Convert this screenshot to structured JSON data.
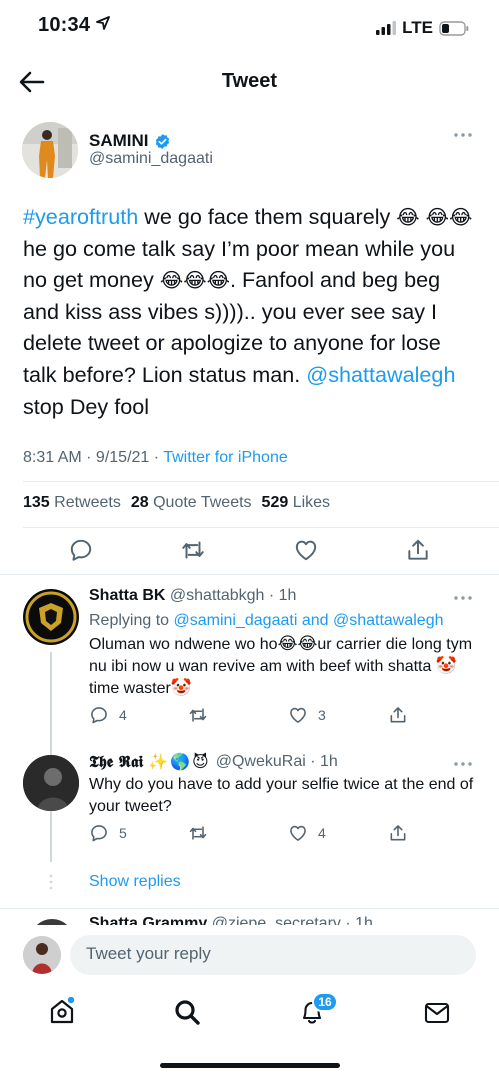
{
  "status_bar": {
    "time": "10:34",
    "network": "LTE"
  },
  "header": {
    "title": "Tweet"
  },
  "main_tweet": {
    "name": "SAMINI",
    "handle": "@samini_dagaati",
    "hashtag": "#yearoftruth",
    "text_1": " we go face them squarely ",
    "text_2": " he go come talk say I’m poor mean while you no get money ",
    "text_3": ". Fanfool and beg beg and kiss ass vibes s)))).. you ever see say I delete tweet or apologize to anyone for lose talk before? Lion status man. ",
    "mention": "@shattawalegh",
    "text_4": " stop Dey fool",
    "emoji": "😂",
    "time": "8:31 AM · 9/15/21 · ",
    "source": "Twitter for iPhone",
    "stats": {
      "retweets": "135",
      "retweets_label": "Retweets",
      "quotes": "28",
      "quotes_label": "Quote Tweets",
      "likes": "529",
      "likes_label": "Likes"
    }
  },
  "replies": [
    {
      "name": "Shatta BK",
      "handle": "@shattabkgh · 1h",
      "replying_prefix": "Replying to ",
      "replying_to": "@samini_dagaati and @shattawalegh",
      "text_1": "Oluman wo ndwene wo ho",
      "emoji_laugh": "😂",
      "text_2": "ur carrier die long tym nu ibi now u wan revive am with beef with shatta ",
      "emoji_clown": "🤡",
      "text_3": "time waster",
      "reply_count": "4",
      "like_count": "3"
    },
    {
      "name": "𝕿𝖍𝖊 𝕽𝖆𝖎",
      "name_emojis": "✨🌎😈",
      "handle": "@QwekuRai · 1h",
      "text": "Why do you have to add your selfie twice at the end of your tweet?",
      "reply_count": "5",
      "like_count": "4"
    }
  ],
  "show_replies": "Show replies",
  "partial_reply": {
    "name": "Shatta Grammy",
    "handle": "@ziepe_secretary · 1h"
  },
  "composer": {
    "placeholder": "Tweet your reply"
  },
  "bottom_nav": {
    "notifications_badge": "16"
  },
  "colors": {
    "accent": "#1d9bf0",
    "text": "#0f1419",
    "muted": "#536471",
    "divider": "#e6ecf0"
  }
}
